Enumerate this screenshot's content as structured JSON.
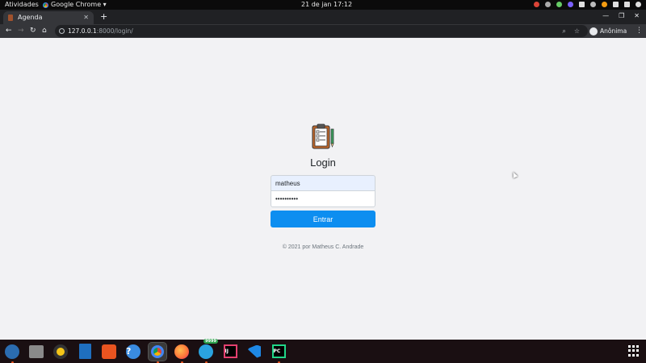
{
  "topbar": {
    "activities": "Atividades",
    "app_name": "Google Chrome ▾",
    "clock": "21 de jan  17:12"
  },
  "browser": {
    "tab_title": "Agenda",
    "url_host": "127.0.0.1",
    "url_path": ":8000/login/",
    "profile_label": "Anônima"
  },
  "login": {
    "title": "Login",
    "username_value": "matheus",
    "password_value": "••••••••••",
    "submit_label": "Entrar",
    "footer": "© 2021 por Matheus C. Andrade"
  },
  "dock": {
    "items": [
      {
        "icon": "thunderbird-icon",
        "color": "#2b6cb0"
      },
      {
        "icon": "files-icon",
        "color": "#8a8a8a"
      },
      {
        "icon": "rhythmbox-icon",
        "color": "#f5c518"
      },
      {
        "icon": "writer-icon",
        "color": "#1f6fbf"
      },
      {
        "icon": "software-icon",
        "color": "#e95420"
      },
      {
        "icon": "help-icon",
        "color": "#3a8be0"
      },
      {
        "icon": "chrome-icon",
        "color": "#4285f4"
      },
      {
        "icon": "firefox-icon",
        "color": "#ff7139"
      },
      {
        "icon": "telegram-icon",
        "color": "#2aa3df"
      },
      {
        "icon": "intellij-icon",
        "color": "#e4406f"
      },
      {
        "icon": "vscode-icon",
        "color": "#1e88e5"
      },
      {
        "icon": "pycharm-icon",
        "color": "#21d789"
      }
    ],
    "telegram_badge": "9999"
  }
}
